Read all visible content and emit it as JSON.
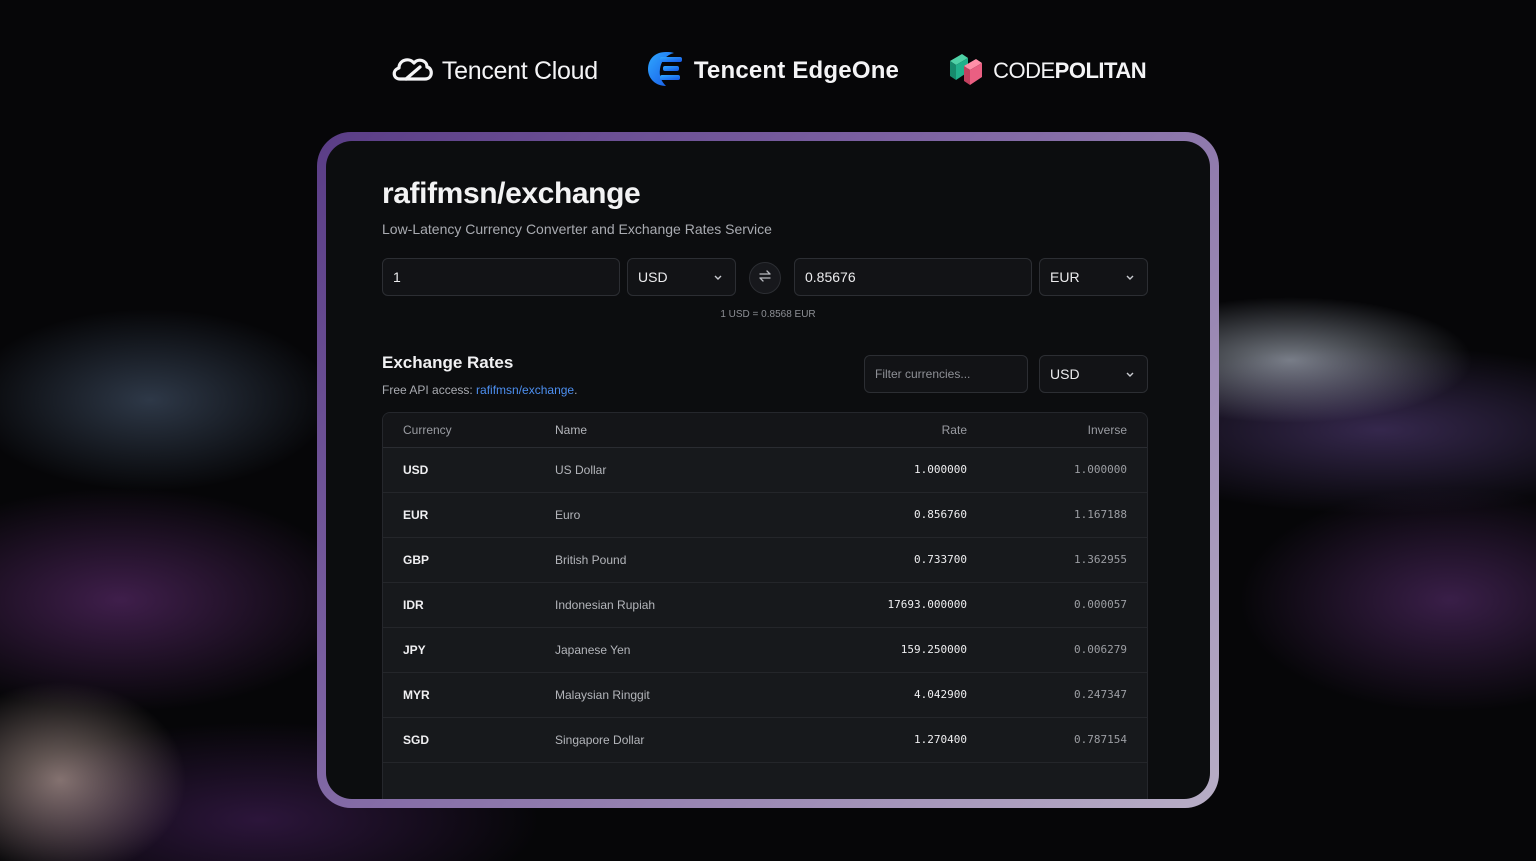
{
  "brands": {
    "tencent_cloud": "Tencent Cloud",
    "edgeone": "Tencent EdgeOne",
    "codepolitan_a": "CODE",
    "codepolitan_b": "POLITAN"
  },
  "app": {
    "title": "rafifmsn/exchange",
    "subtitle": "Low-Latency Currency Converter and Exchange Rates Service"
  },
  "converter": {
    "amount": "1",
    "from_currency": "USD",
    "result": "0.85676",
    "to_currency": "EUR",
    "rate_text": "1 USD = 0.8568 EUR"
  },
  "rates_section": {
    "title": "Exchange Rates",
    "api_prefix": "Free API access: ",
    "api_link": "rafifmsn/exchange",
    "api_suffix": ".",
    "filter_placeholder": "Filter currencies...",
    "base_currency": "USD"
  },
  "table": {
    "headers": [
      "Currency",
      "Name",
      "Rate",
      "Inverse"
    ],
    "rows": [
      {
        "code": "USD",
        "name": "US Dollar",
        "rate": "1.000000",
        "inverse": "1.000000"
      },
      {
        "code": "EUR",
        "name": "Euro",
        "rate": "0.856760",
        "inverse": "1.167188"
      },
      {
        "code": "GBP",
        "name": "British Pound",
        "rate": "0.733700",
        "inverse": "1.362955"
      },
      {
        "code": "IDR",
        "name": "Indonesian Rupiah",
        "rate": "17693.000000",
        "inverse": "0.000057"
      },
      {
        "code": "JPY",
        "name": "Japanese Yen",
        "rate": "159.250000",
        "inverse": "0.006279"
      },
      {
        "code": "MYR",
        "name": "Malaysian Ringgit",
        "rate": "4.042900",
        "inverse": "0.247347"
      },
      {
        "code": "SGD",
        "name": "Singapore Dollar",
        "rate": "1.270400",
        "inverse": "0.787154"
      }
    ]
  },
  "colors": {
    "link": "#4d8ff0",
    "panel": "#0c0d0f",
    "frame_accent": "#7a5fa0"
  }
}
